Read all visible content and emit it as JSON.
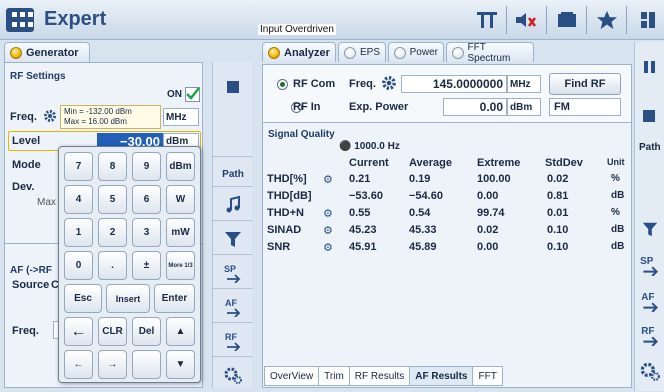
{
  "titlebar": {
    "title": "Expert",
    "overdriven": "Input Overdriven"
  },
  "generator": {
    "tab_label": "Generator",
    "rf_settings": {
      "title": "RF Settings",
      "on_label": "ON",
      "freq_label": "Freq.",
      "freq_hint_min": "Min = -132.00 dBm",
      "freq_hint_max": "Max = 16.00 dBm",
      "freq_unit": "MHz",
      "level_label": "Level",
      "level_value": "−30.00",
      "level_unit": "dBm",
      "mode_label": "Mode",
      "dev_label": "Dev.",
      "max_label": "Max"
    },
    "af": {
      "title": "AF (->RF",
      "source_label": "Source",
      "source_value": "C",
      "freq_label": "Freq."
    },
    "side_buttons": [
      "Path"
    ]
  },
  "keypad": {
    "rows": [
      [
        "7",
        "8",
        "9",
        "dBm"
      ],
      [
        "4",
        "5",
        "6",
        "W"
      ],
      [
        "1",
        "2",
        "3",
        "mW"
      ],
      [
        "0",
        ".",
        "±",
        "More 1/3"
      ],
      [
        "Esc",
        "Insert",
        "Enter"
      ],
      [
        "←",
        "CLR",
        "Del",
        "▲"
      ],
      [
        "←",
        "→",
        "",
        "▼"
      ]
    ]
  },
  "analyzer": {
    "tabs": [
      {
        "label": "Analyzer",
        "active": true
      },
      {
        "label": "EPS",
        "active": false
      },
      {
        "label": "Power",
        "active": false
      },
      {
        "label": "FFT Spectrum",
        "active": false
      }
    ],
    "rf_com_label": "RF Com",
    "rf_in_label": "RF In",
    "freq_label": "Freq.",
    "freq_value": "145.0000000",
    "freq_unit": "MHz",
    "find_rf_label": "Find RF",
    "exp_power_label": "Exp. Power",
    "exp_power_value": "0.00",
    "exp_power_unit": "dBm",
    "mode_value": "FM",
    "signal_quality": {
      "title": "Signal Quality",
      "tone": "1000.0 Hz",
      "headers": [
        "Current",
        "Average",
        "Extreme",
        "StdDev",
        "Unit"
      ],
      "rows": [
        {
          "name": "THD[%]",
          "dot": true,
          "current": "0.21",
          "average": "0.19",
          "extreme": "100.00",
          "stddev": "0.02",
          "unit": "%"
        },
        {
          "name": "THD[dB]",
          "dot": false,
          "current": "−53.60",
          "average": "−54.60",
          "extreme": "0.00",
          "stddev": "0.81",
          "unit": "dB"
        },
        {
          "name": "THD+N",
          "dot": true,
          "current": "0.55",
          "average": "0.54",
          "extreme": "99.74",
          "stddev": "0.01",
          "unit": "%"
        },
        {
          "name": "SINAD",
          "dot": true,
          "current": "45.23",
          "average": "45.33",
          "extreme": "0.02",
          "stddev": "0.10",
          "unit": "dB"
        },
        {
          "name": "SNR",
          "dot": true,
          "current": "45.91",
          "average": "45.89",
          "extreme": "0.00",
          "stddev": "0.10",
          "unit": "dB"
        }
      ]
    },
    "bottom_tabs": [
      {
        "label": "OverView",
        "active": false
      },
      {
        "label": "Trim",
        "active": false
      },
      {
        "label": "RF Results",
        "active": false
      },
      {
        "label": "AF Results",
        "active": true
      },
      {
        "label": "FFT",
        "active": false
      }
    ]
  },
  "right_side": {
    "path_label": "Path"
  },
  "colors": {
    "accent": "#2a4f85",
    "led_on": "#f1b400",
    "check": "#1aa44a"
  }
}
